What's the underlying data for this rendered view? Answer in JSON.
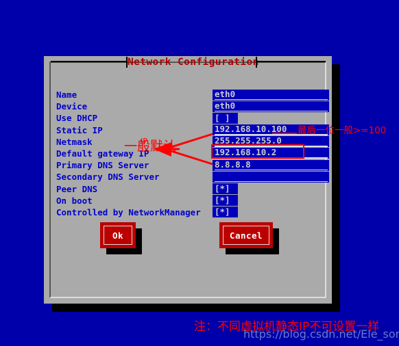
{
  "screen": {
    "background_color": "#0000aa"
  },
  "dialog": {
    "title": "Network Configuration",
    "title_color": "#aa0000",
    "background_color": "#aaaaaa"
  },
  "form": {
    "rows": [
      {
        "label": "Name",
        "value": "eth0",
        "type": "text"
      },
      {
        "label": "Device",
        "value": "eth0",
        "type": "text"
      },
      {
        "label": "Use DHCP",
        "value": "[ ]",
        "type": "checkbox"
      },
      {
        "label": "Static IP",
        "value": "192.168.10.100",
        "type": "text"
      },
      {
        "label": "Netmask",
        "value": "255.255.255.0",
        "type": "text"
      },
      {
        "label": "Default gateway IP",
        "value": "192.168.10.2",
        "type": "text"
      },
      {
        "label": "Primary DNS Server",
        "value": "8.8.8.8",
        "type": "text"
      },
      {
        "label": "Secondary DNS Server",
        "value": "",
        "type": "text"
      },
      {
        "label": "Peer DNS",
        "value": "[*]",
        "type": "checkbox"
      },
      {
        "label": "On boot",
        "value": "[*]",
        "type": "checkbox"
      },
      {
        "label": "Controlled by NetworkManager",
        "value": "[*]",
        "type": "checkbox"
      }
    ]
  },
  "buttons": {
    "ok_label": "Ok",
    "cancel_label": "Cancel",
    "color": "#bb0000"
  },
  "annotations": {
    "static_ip_note": "最后一位一般>=100",
    "gateway_note": "一般默认",
    "gateway_note_overlay": "IP",
    "bottom_note": "注：不同虚拟机静态IP不可设置一样",
    "color": "#ff0000"
  },
  "watermark": {
    "text": "https://blog.csdn.net/Ele_sorriu"
  }
}
